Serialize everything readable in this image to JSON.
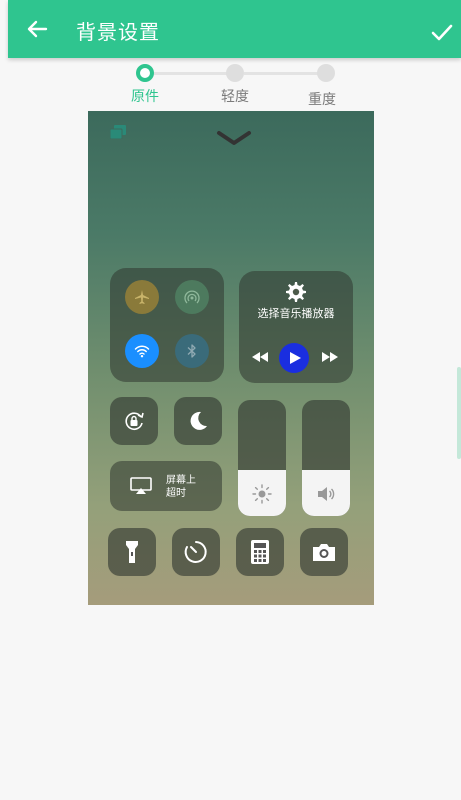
{
  "appbar": {
    "title": "背景设置",
    "back_icon": "arrow-left-icon",
    "confirm_icon": "check-icon",
    "color": "#2fc58f"
  },
  "stepper": {
    "steps": [
      {
        "label": "原件",
        "active": true
      },
      {
        "label": "轻度",
        "active": false
      },
      {
        "label": "重度",
        "active": false
      }
    ]
  },
  "preview": {
    "music_panel": {
      "title": "选择音乐播放器",
      "icons": [
        "gear-icon",
        "rewind-icon",
        "play-icon",
        "fast-forward-icon"
      ]
    },
    "connectivity": [
      "airplane-icon",
      "hotspot-icon",
      "wifi-icon",
      "bluetooth-icon"
    ],
    "screen_mirror_label": "屏幕上\n超时",
    "brightness_level": 0.4,
    "volume_level": 0.4,
    "bottom_row": [
      "flashlight-icon",
      "timer-icon",
      "calculator-icon",
      "camera-icon"
    ]
  }
}
